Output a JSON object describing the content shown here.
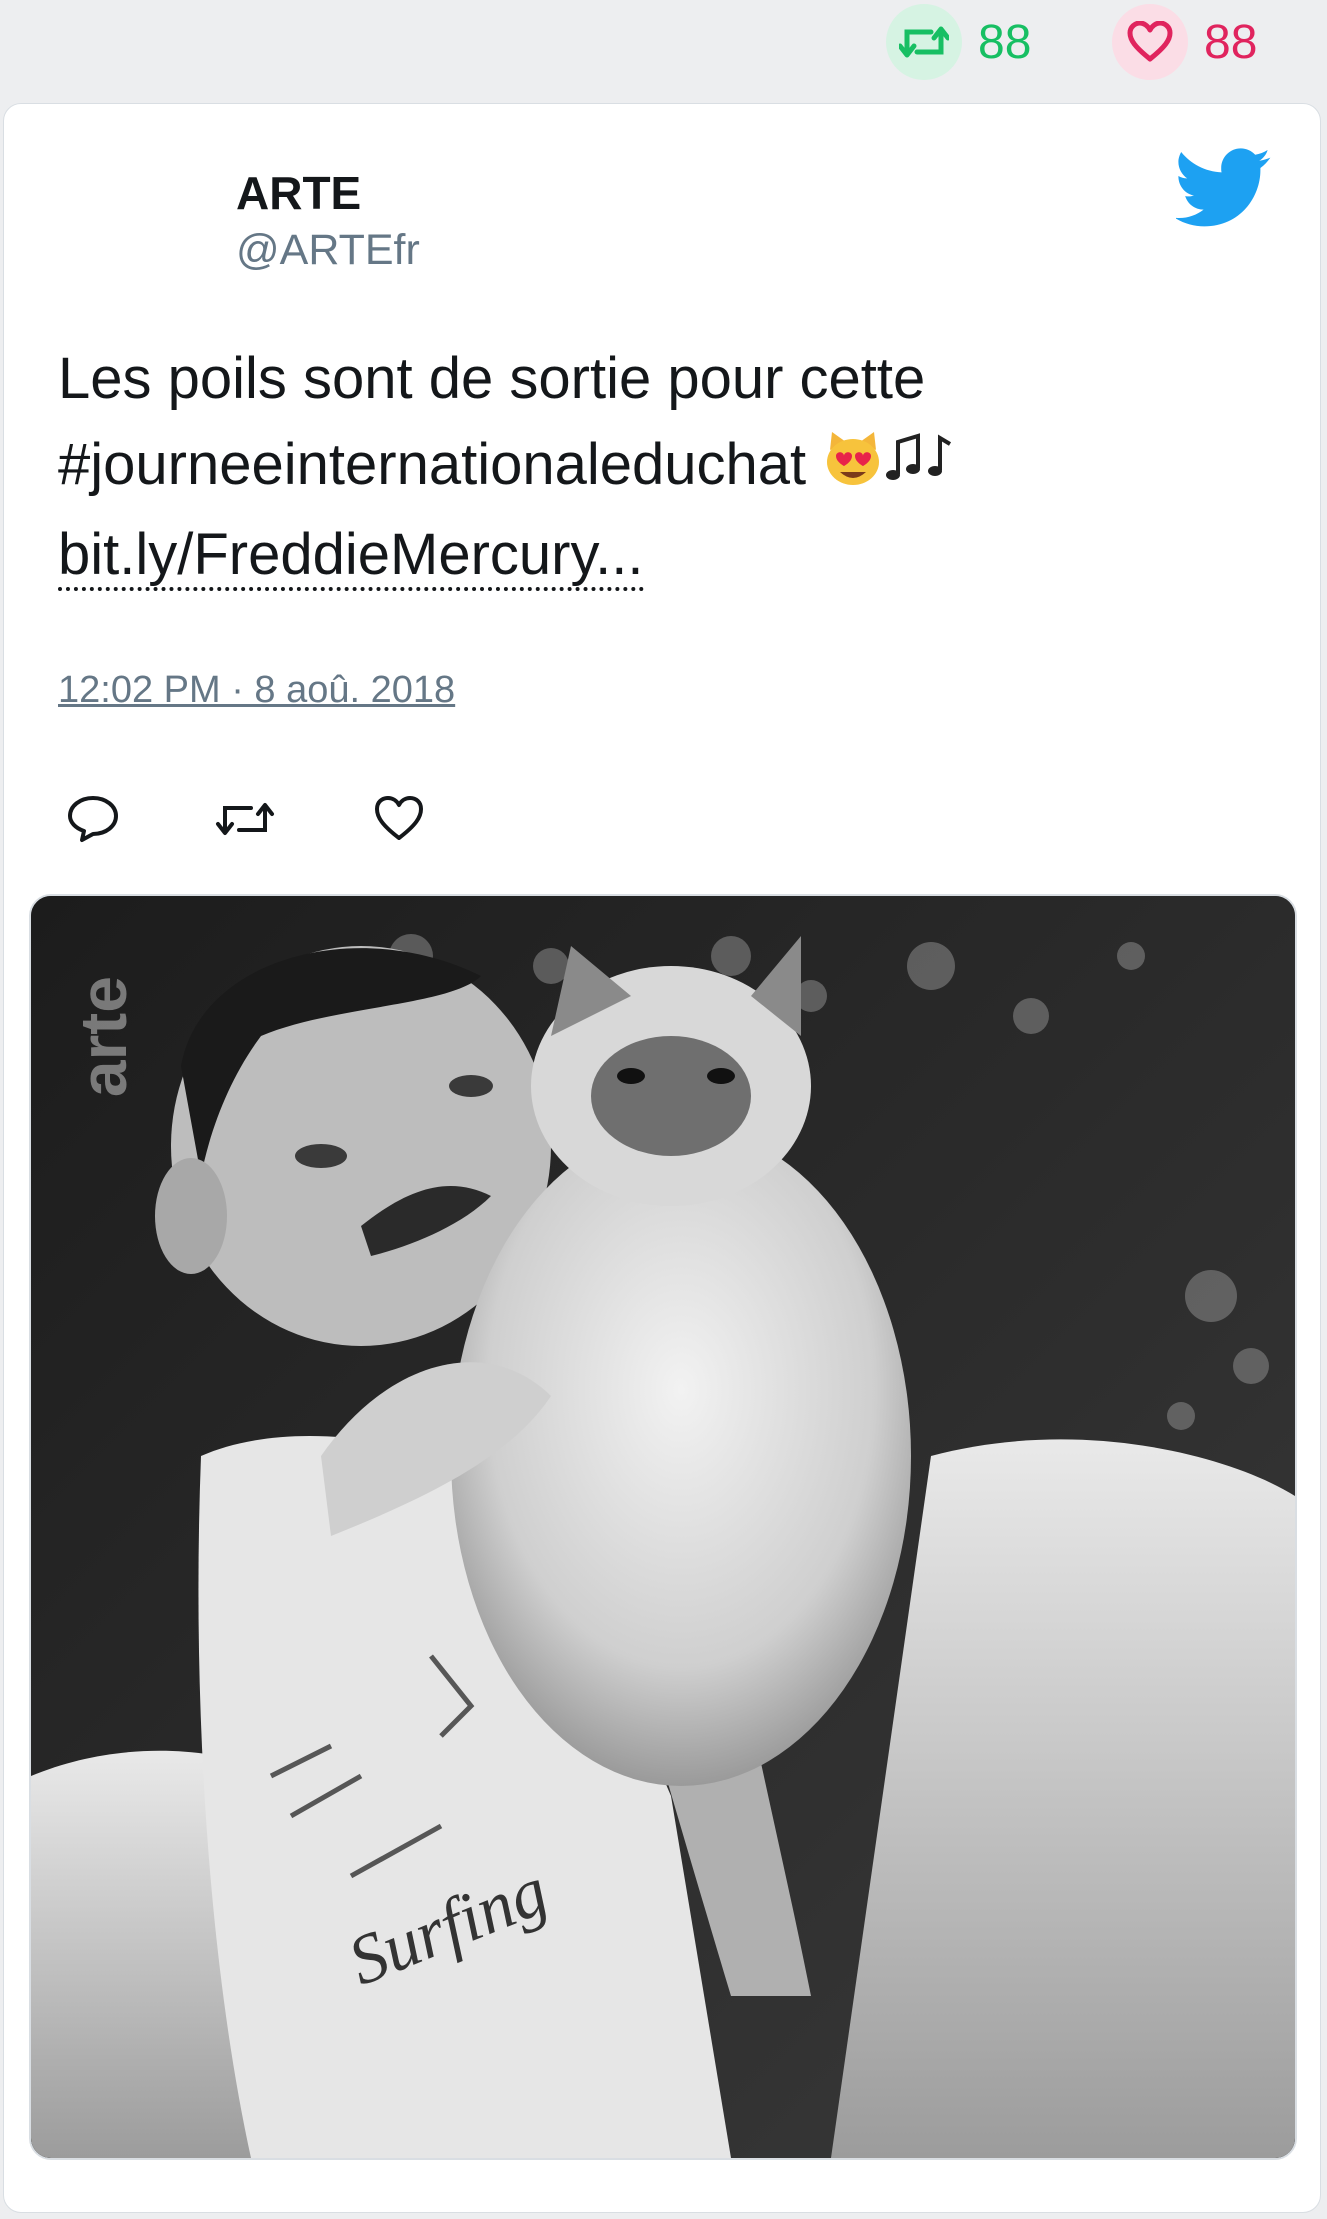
{
  "stats": {
    "retweets": "88",
    "likes": "88",
    "retweet_icon": "retweet-icon",
    "like_icon": "heart-icon"
  },
  "tweet": {
    "author_name": "ARTE",
    "author_handle": "@ARTEfr",
    "text_line1": "Les poils sont de sortie pour cette",
    "text_hashtag": "#journeeinternationaleduchat",
    "link": "bit.ly/FreddieMercury...",
    "timestamp": "12:02 PM · 8 aoû. 2018"
  },
  "media": {
    "watermark": "arte",
    "shirt_text": "Surfing"
  },
  "colors": {
    "retweet": "#17bf63",
    "like": "#e0245e",
    "twitter_blue": "#1da1f2",
    "muted": "#657786"
  }
}
